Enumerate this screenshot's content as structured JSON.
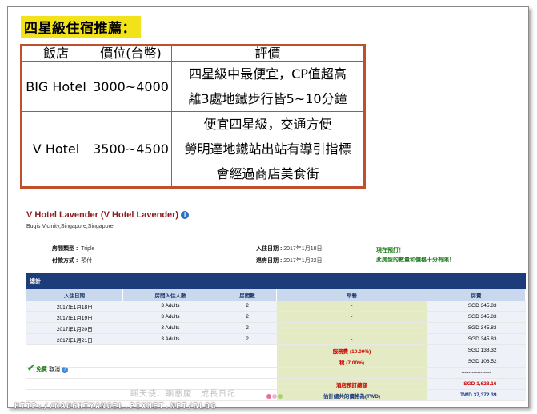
{
  "heading": "四星級住宿推薦：",
  "table": {
    "headers": [
      "飯店",
      "價位(台幣)",
      "評價"
    ],
    "rows": [
      {
        "hotel": "BIG Hotel",
        "price": "3000~4000",
        "reviews": [
          "四星級中最便宜，CP值超高",
          "離3處地鐵步行皆5~10分鐘"
        ]
      },
      {
        "hotel": "V Hotel",
        "price": "3500~4500",
        "reviews": [
          "便宜四星級，交通方便",
          "勞明達地鐵站出站有導引指標",
          "會經過商店美食街"
        ]
      }
    ]
  },
  "booking": {
    "title": "V Hotel Lavender (V Hotel Lavender)",
    "location": "Bugis Vicinity,Singapore,Singapore",
    "room_type_label": "房間類型 :",
    "room_type": "Triple",
    "payment_label": "付款方式 :",
    "payment": "預付",
    "checkin_label": "入住日期 :",
    "checkin": "2017年1月18日",
    "checkout_label": "退房日期 :",
    "checkout": "2017年1月22日",
    "notice_line1": "現在預訂！",
    "notice_line2": "此房型的數量和價格十分有限！",
    "summary_label": "總計",
    "detail_headers": [
      "入住日期",
      "房間入住人數",
      "房間數",
      "早餐",
      "房費"
    ],
    "detail_rows": [
      {
        "date": "2017年1月18日",
        "guests": "3 Adults",
        "rooms": "2",
        "breakfast": "-",
        "fee": "SGD 345.83"
      },
      {
        "date": "2017年1月19日",
        "guests": "3 Adults",
        "rooms": "2",
        "breakfast": "-",
        "fee": "SGD 345.83"
      },
      {
        "date": "2017年1月20日",
        "guests": "3 Adults",
        "rooms": "2",
        "breakfast": "-",
        "fee": "SGD 345.83"
      },
      {
        "date": "2017年1月21日",
        "guests": "3 Adults",
        "rooms": "2",
        "breakfast": "-",
        "fee": "SGD 345.83"
      }
    ],
    "service_label": "服務費 (10.00%)",
    "service_fee": "SGD 138.32",
    "tax_label": "稅 (7.00%)",
    "tax_fee": "SGD 106.52",
    "dash_line": "-----------------",
    "total_label": "酒店預訂總額",
    "total": "SGD 1,628.16",
    "est_label": "估計總共的價格為(TWD)",
    "est_total": "TWD 37,372.39",
    "free_label": "免費",
    "cancel_label": "取消"
  },
  "watermark": "睏天使．睏惡魔．成長日記",
  "url": "HTTP://NAUGHTYANGEL.PIXNET.NET/BLOG"
}
